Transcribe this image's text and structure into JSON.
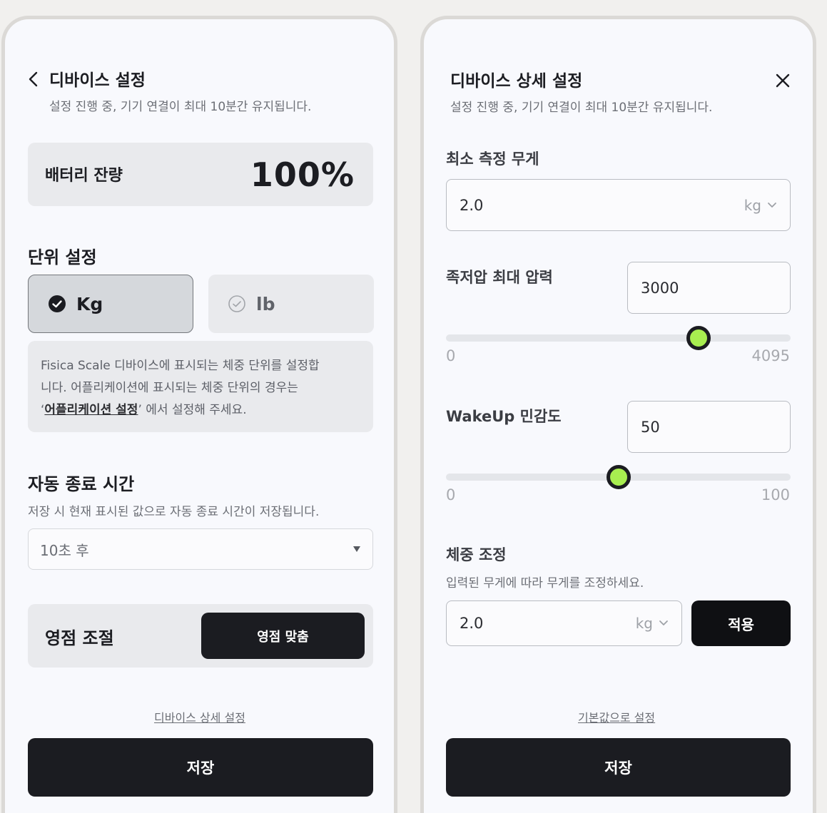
{
  "device_settings": {
    "title": "디바이스 설정",
    "subtitle": "설정 진행 중, 기기 연결이 최대 10분간 유지됩니다.",
    "battery": {
      "label": "배터리 잔량",
      "value": "100%"
    },
    "unit_settings": {
      "title": "단위 설정",
      "options": [
        {
          "label": "Kg",
          "selected": true
        },
        {
          "label": "lb",
          "selected": false
        }
      ],
      "info_line1": "Fisica Scale 디바이스에 표시되는 체중 단위를 설정합",
      "info_line2": "니다. 어플리케이션에 표시되는 체중 단위의 경우는",
      "info_quote_open": "‘",
      "info_link": "어플리케이션 설정",
      "info_tail": "’ 에서 설정해 주세요."
    },
    "auto_off": {
      "title": "자동 종료 시간",
      "subtitle": "저장 시 현재 표시된 값으로 자동 종료 시간이 저장됩니다.",
      "selected": "10초 후"
    },
    "zero_adjust": {
      "label": "영점 조절",
      "button": "영점 맞춤"
    },
    "detail_link": "디바이스 상세 설정",
    "save_button": "저장"
  },
  "device_detail_settings": {
    "title": "디바이스 상세 설정",
    "subtitle": "설정 진행 중, 기기 연결이 최대 10분간 유지됩니다.",
    "min_weight": {
      "label": "최소 측정 무게",
      "value": "2.0",
      "unit": "kg"
    },
    "foot_pressure": {
      "label": "족저압 최대 압력",
      "value": "3000",
      "min": "0",
      "max": "4095",
      "level": 3000
    },
    "wakeup": {
      "label": "WakeUp 민감도",
      "value": "50",
      "min": "0",
      "max": "100",
      "level": 50
    },
    "weight_adjust": {
      "title": "체중 조정",
      "subtitle": "입력된 무게에 따라 무게를 조정하세요.",
      "value": "2.0",
      "unit": "kg",
      "apply_button": "적용"
    },
    "reset_link": "기본값으로 설정",
    "save_button": "저장"
  },
  "icons": {
    "back": "chevron-left-icon",
    "close": "close-icon",
    "check_selected": "check-circle-filled-icon",
    "check_unselected": "check-circle-outline-icon",
    "dropdown": "caret-down-icon",
    "chevron_down": "chevron-down-icon"
  },
  "colors": {
    "background": "#f1f0ee",
    "panel": "#f8f9fd",
    "dark": "#1b1c21",
    "card": "#e9eaed",
    "slider_thumb": "#a8ee50"
  }
}
